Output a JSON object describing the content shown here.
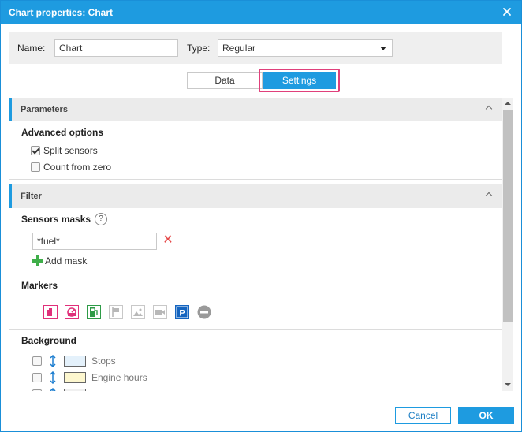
{
  "dialog": {
    "title": "Chart properties: Chart"
  },
  "header": {
    "name_label": "Name:",
    "name_value": "Chart",
    "type_label": "Type:",
    "type_value": "Regular"
  },
  "tabs": [
    {
      "label": "Data",
      "active": false
    },
    {
      "label": "Settings",
      "active": true
    }
  ],
  "parameters": {
    "title": "Parameters",
    "advanced_title": "Advanced options",
    "options": [
      {
        "label": "Split sensors",
        "checked": true
      },
      {
        "label": "Count from zero",
        "checked": false
      }
    ]
  },
  "filter": {
    "title": "Filter",
    "sensors_masks_title": "Sensors masks",
    "help_glyph": "?",
    "mask_value": "*fuel*",
    "delete_glyph": "✕",
    "add_mask_label": "Add mask"
  },
  "markers": {
    "title": "Markers",
    "icons": [
      {
        "name": "fuel-filling-marker-icon",
        "color": "#e0307a"
      },
      {
        "name": "speed-marker-icon",
        "color": "#e0307a"
      },
      {
        "name": "fuel-station-marker-icon",
        "color": "#2e9b47"
      },
      {
        "name": "flag-marker-icon",
        "color": "#b8b8b8"
      },
      {
        "name": "image-marker-icon",
        "color": "#b8b8b8"
      },
      {
        "name": "video-marker-icon",
        "color": "#b8b8b8"
      },
      {
        "name": "parking-marker-icon",
        "color": "#1565c0"
      },
      {
        "name": "stop-marker-icon",
        "color": "#999999"
      }
    ]
  },
  "background": {
    "title": "Background",
    "items": [
      {
        "label": "Stops",
        "swatch": "#e4f1fb"
      },
      {
        "label": "Engine hours",
        "swatch": "#fdf7cf"
      },
      {
        "label": "",
        "swatch": "#f0f0f0"
      }
    ]
  },
  "footer": {
    "cancel_label": "Cancel",
    "ok_label": "OK"
  },
  "colors": {
    "accent": "#1e9be0",
    "highlight": "#e0407b"
  }
}
